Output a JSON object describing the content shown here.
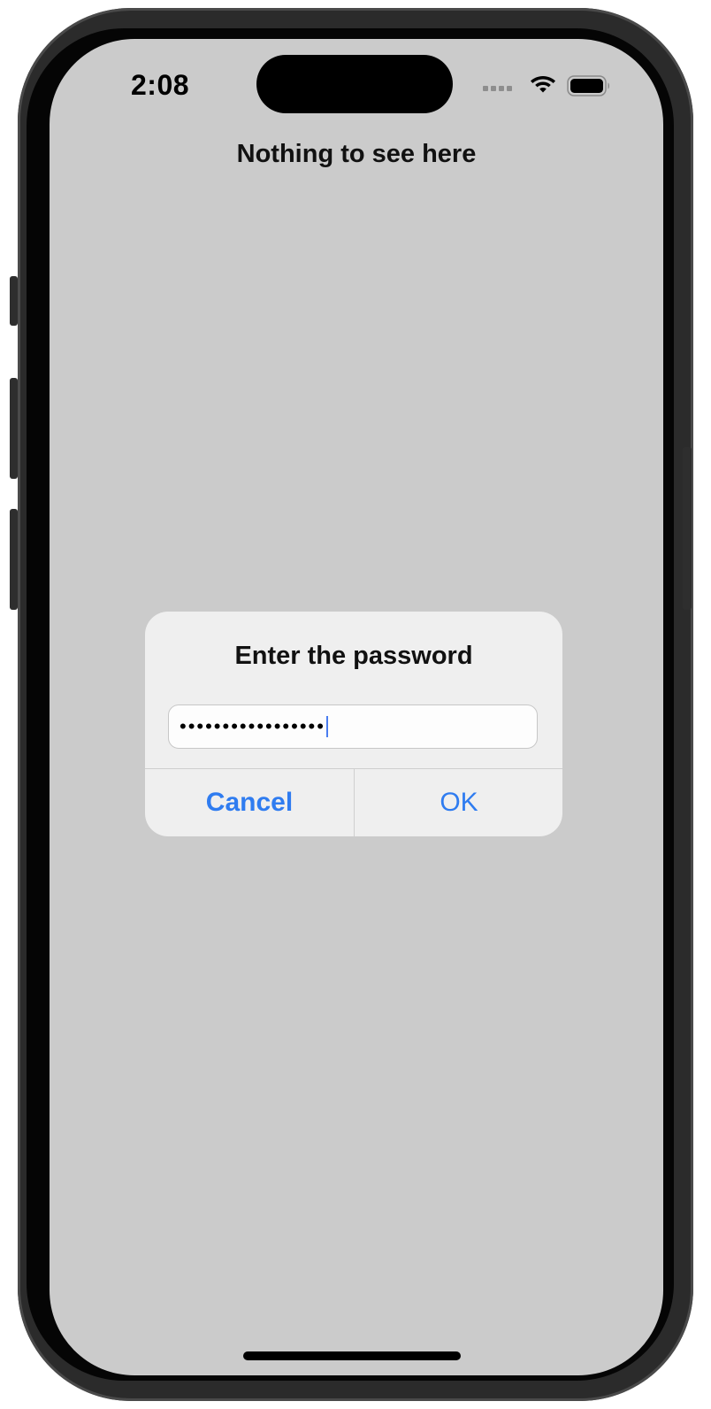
{
  "status_bar": {
    "time": "2:08",
    "icons": [
      "cellular-signal-icon",
      "wifi-icon",
      "battery-icon"
    ]
  },
  "page": {
    "title": "Nothing to see here"
  },
  "alert": {
    "title": "Enter the password",
    "input_value": "•••••••••••••••••",
    "cancel_label": "Cancel",
    "ok_label": "OK"
  },
  "colors": {
    "screen_background": "#cbcbcb",
    "alert_background": "#efefef",
    "accent": "#2f7cf0"
  }
}
